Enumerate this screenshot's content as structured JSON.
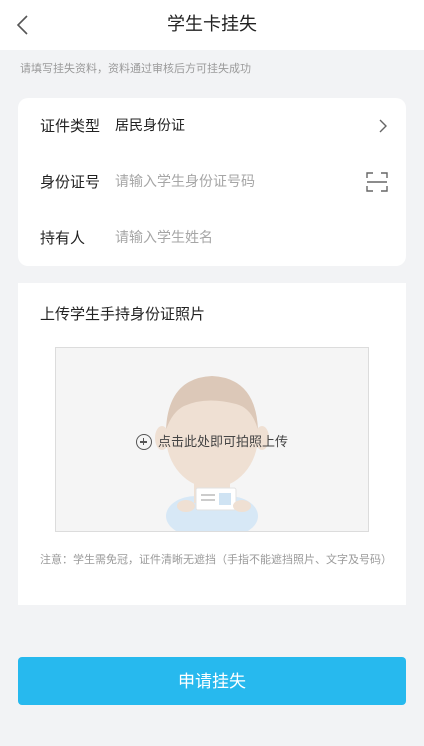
{
  "header": {
    "title": "学生卡挂失",
    "back_icon": "chevron-left-icon"
  },
  "hint": "请填写挂失资料，资料通过审核后方可挂失成功",
  "form": {
    "id_type": {
      "label": "证件类型",
      "value": "居民身份证",
      "icon": "chevron-right-icon"
    },
    "id_number": {
      "label": "身份证号",
      "placeholder": "请输入学生身份证号码",
      "icon": "scan-icon"
    },
    "holder": {
      "label": "持有人",
      "placeholder": "请输入学生姓名"
    }
  },
  "upload": {
    "title": "上传学生手持身份证照片",
    "prompt": "点击此处即可拍照上传",
    "note": "注意：学生需免冠，证件清晰无遮挡（手指不能遮挡照片、文字及号码）"
  },
  "submit_label": "申请挂失",
  "colors": {
    "primary": "#27b9ee",
    "background": "#f2f3f5"
  }
}
